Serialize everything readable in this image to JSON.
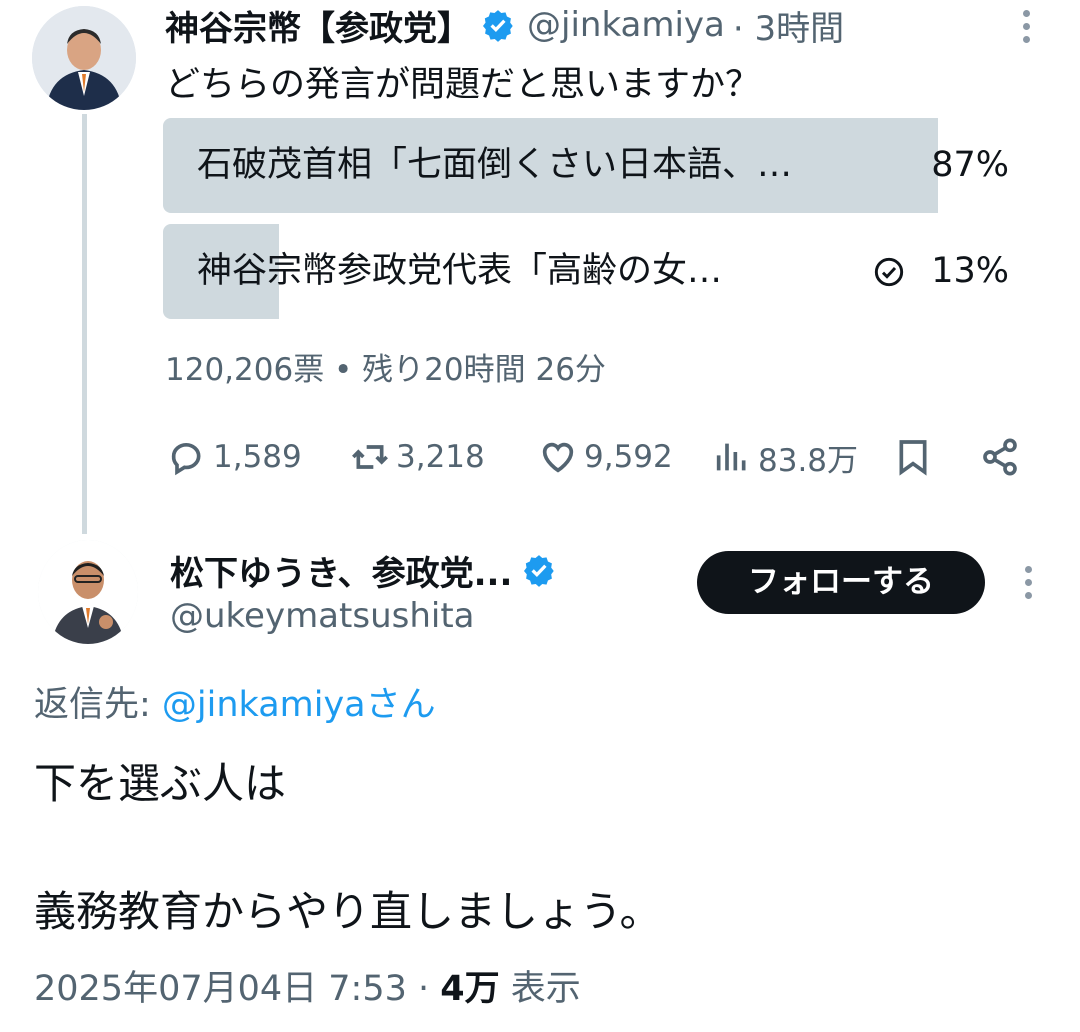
{
  "tweet1": {
    "display_name": "神谷宗幣【参政党】",
    "handle": "@jinkamiya",
    "time": "· 3時間",
    "text": "どちらの発言が問題だと思いますか？",
    "poll": {
      "options": [
        {
          "label": "石破茂首相「七面倒くさい日本語、…",
          "percent_text": "87%",
          "percent": 87,
          "chosen": false
        },
        {
          "label": "神谷宗幣参政党代表「高齢の女…",
          "percent_text": "13%",
          "percent": 13,
          "chosen": true
        }
      ],
      "summary": "120,206票 • 残り20時間 26分"
    },
    "actions": {
      "replies": "1,589",
      "retweets": "3,218",
      "likes": "9,592",
      "views": "83.8万"
    }
  },
  "tweet2": {
    "display_name": "松下ゆうき、参政党...",
    "handle": "@ukeymatsushita",
    "follow_label": "フォローする",
    "reply_to_prefix": "返信先: ",
    "reply_to_handle": "@jinkamiyaさん",
    "text_line1": "下を選ぶ人は",
    "text_line2": "義務教育からやり直しましょう。",
    "timestamp": "2025年07月04日 7:53 · ",
    "views_count": "4万",
    "views_label": " 表示"
  },
  "colors": {
    "verified": "#1d9bf0",
    "link": "#1d9bf0",
    "secondary_text": "#536471",
    "poll_bar": "#cfd9de",
    "follow_button": "#0f1419"
  },
  "icons": [
    "verified-badge-icon",
    "more-icon",
    "reply-icon",
    "retweet-icon",
    "like-icon",
    "views-icon",
    "bookmark-icon",
    "share-icon",
    "check-circle-icon"
  ]
}
